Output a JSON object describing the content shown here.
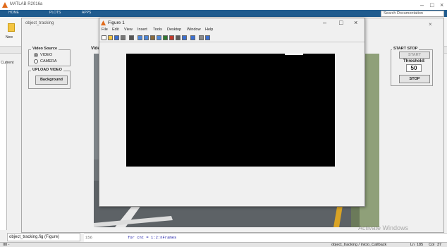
{
  "matlab": {
    "title": "MATLAB R2016a",
    "tabs": [
      "HOME",
      "PLOTS",
      "APPS"
    ],
    "search_placeholder": "Search Documentation",
    "new_label": "New",
    "current_folder_label": "Current"
  },
  "guide": {
    "title": "object_tracking",
    "video_source": {
      "title": "Video Source",
      "options": [
        {
          "label": "VIDEO",
          "selected": true
        },
        {
          "label": "CAMERA",
          "selected": false
        }
      ]
    },
    "upload_video": {
      "title": "UPLOAD VIDEO",
      "button_label": "Background"
    },
    "video_panel_label": "Vide",
    "start_stop": {
      "title": "START STOP",
      "start_label": "START",
      "threshold_label": "Threshold:",
      "threshold_value": "50",
      "stop_label": "STOP"
    }
  },
  "figure": {
    "title": "Figure 1",
    "menu": [
      "File",
      "Edit",
      "View",
      "Insert",
      "Tools",
      "Desktop",
      "Window",
      "Help"
    ],
    "toolbar_icons": [
      "new-figure-icon",
      "open-icon",
      "save-icon",
      "print-icon",
      "pointer-icon",
      "zoom-in-icon",
      "zoom-out-icon",
      "pan-icon",
      "rotate-icon",
      "data-cursor-icon",
      "brush-icon",
      "link-icon",
      "colorbar-icon",
      "legend-icon",
      "hide-plot-tools-icon",
      "show-plot-tools-icon"
    ]
  },
  "code": {
    "line_number": "156",
    "text": "for cnt = 1:2:nFrames"
  },
  "workspace_tab": "object_tracking.fig (Figure)",
  "status": {
    "left": "IIII -",
    "callback": "object_tracking / inicio_Callback",
    "ln_label": "Ln",
    "ln_value": "185",
    "col_label": "Col",
    "col_value": "37"
  },
  "activate_windows": "Activate Windows"
}
